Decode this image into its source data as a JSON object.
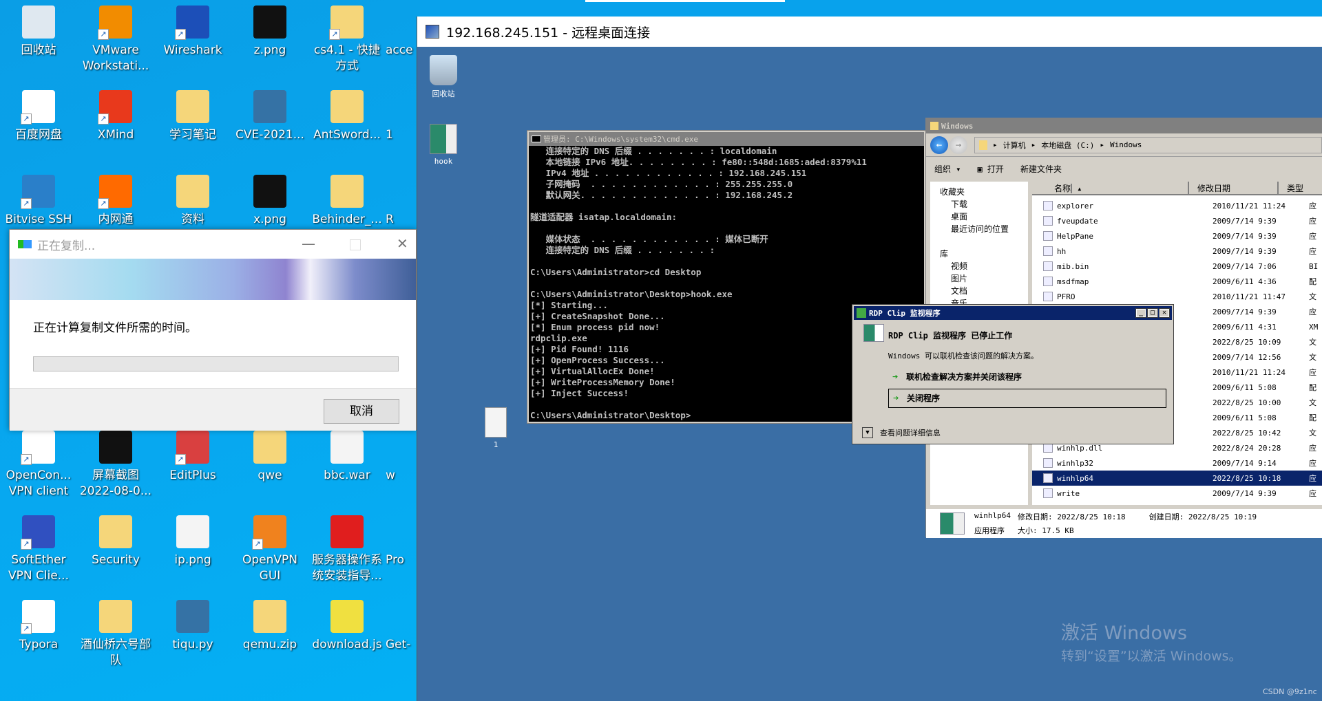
{
  "desktop": {
    "icons": [
      {
        "label": "回收站",
        "icon": "recycle-bin-icon",
        "color": "#dfe8f0",
        "shortcut": false
      },
      {
        "label": "VMware Workstati...",
        "icon": "vmware-icon",
        "color": "#f28c00",
        "shortcut": true
      },
      {
        "label": "Wireshark",
        "icon": "wireshark-icon",
        "color": "#1c4fb8",
        "shortcut": true
      },
      {
        "label": "z.png",
        "icon": "image-file-icon",
        "color": "#111111",
        "shortcut": false
      },
      {
        "label": "cs4.1 - 快捷方式",
        "icon": "folder-icon",
        "color": "#f5d67a",
        "shortcut": true
      },
      {
        "label": "百度网盘",
        "icon": "baidu-netdisk-icon",
        "color": "#ffffff",
        "shortcut": true
      },
      {
        "label": "XMind",
        "icon": "xmind-icon",
        "color": "#e8391c",
        "shortcut": true
      },
      {
        "label": "学习笔记",
        "icon": "folder-icon",
        "color": "#f5d67a",
        "shortcut": false
      },
      {
        "label": "CVE-2021...",
        "icon": "python-file-icon",
        "color": "#3572a5",
        "shortcut": false
      },
      {
        "label": "AntSword...",
        "icon": "zip-folder-icon",
        "color": "#f5d67a",
        "shortcut": false
      },
      {
        "label": "Bitvise SSH",
        "icon": "bitvise-icon",
        "color": "#2a7fc9",
        "shortcut": true
      },
      {
        "label": "内网通",
        "icon": "neiwangtong-icon",
        "color": "#ff6a00",
        "shortcut": true
      },
      {
        "label": "资料",
        "icon": "folder-icon",
        "color": "#f5d67a",
        "shortcut": false
      },
      {
        "label": "x.png",
        "icon": "image-file-icon",
        "color": "#111111",
        "shortcut": false
      },
      {
        "label": "Behinder_...",
        "icon": "zip-folder-icon",
        "color": "#f5d67a",
        "shortcut": false
      },
      {
        "label": "OpenCon... VPN client",
        "icon": "lock-icon",
        "color": "#ffffff",
        "shortcut": true
      },
      {
        "label": "屏幕截图 2022-08-0...",
        "icon": "image-file-icon",
        "color": "#111111",
        "shortcut": false
      },
      {
        "label": "EditPlus",
        "icon": "editplus-icon",
        "color": "#d94040",
        "shortcut": true
      },
      {
        "label": "qwe",
        "icon": "folder-icon",
        "color": "#f5d67a",
        "shortcut": false
      },
      {
        "label": "bbc.war",
        "icon": "file-icon",
        "color": "#f4f4f4",
        "shortcut": false
      },
      {
        "label": "SoftEther VPN Clie...",
        "icon": "softether-icon",
        "color": "#3050c0",
        "shortcut": true
      },
      {
        "label": "Security",
        "icon": "folder-icon",
        "color": "#f5d67a",
        "shortcut": false
      },
      {
        "label": "ip.png",
        "icon": "image-file-icon",
        "color": "#f4f4f4",
        "shortcut": false
      },
      {
        "label": "OpenVPN GUI",
        "icon": "openvpn-icon",
        "color": "#f0821e",
        "shortcut": true
      },
      {
        "label": "服务器操作系统安装指导...",
        "icon": "pdf-icon",
        "color": "#e01e1e",
        "shortcut": false
      },
      {
        "label": "Typora",
        "icon": "typora-icon",
        "color": "#ffffff",
        "shortcut": true
      },
      {
        "label": "酒仙桥六号部队",
        "icon": "folder-icon",
        "color": "#f5d67a",
        "shortcut": false
      },
      {
        "label": "tiqu.py",
        "icon": "python-file-icon",
        "color": "#3572a5",
        "shortcut": false
      },
      {
        "label": "qemu.zip",
        "icon": "zip-folder-icon",
        "color": "#f5d67a",
        "shortcut": false
      },
      {
        "label": "download.js",
        "icon": "script-file-icon",
        "color": "#f0e040",
        "shortcut": false
      }
    ],
    "cut_labels": [
      "acce",
      "1",
      "R",
      "w",
      "Pro",
      "Get-"
    ]
  },
  "copy_dialog": {
    "title": "正在复制...",
    "message": "正在计算复制文件所需的时间。",
    "progress_percent": 0,
    "cancel_label": "取消"
  },
  "rdp": {
    "title": "192.168.245.151 - 远程桌面连接",
    "icons": [
      {
        "label": "回收站"
      },
      {
        "label": "hook"
      },
      {
        "label": "1"
      }
    ],
    "cmd": {
      "title": "管理员: C:\\Windows\\system32\\cmd.exe",
      "lines": [
        "   连接特定的 DNS 后缀 . . . . . . . : localdomain",
        "   本地链接 IPv6 地址. . . . . . . . : fe80::548d:1685:aded:8379%11",
        "   IPv4 地址 . . . . . . . . . . . . : 192.168.245.151",
        "   子网掩码  . . . . . . . . . . . . : 255.255.255.0",
        "   默认网关. . . . . . . . . . . . . : 192.168.245.2",
        "",
        "隧道适配器 isatap.localdomain:",
        "",
        "   媒体状态  . . . . . . . . . . . . : 媒体已断开",
        "   连接特定的 DNS 后缀 . . . . . . . :",
        "",
        "C:\\Users\\Administrator>cd Desktop",
        "",
        "C:\\Users\\Administrator\\Desktop>hook.exe",
        "[*] Starting...",
        "[+] CreateSnapshot Done...",
        "[*] Enum process pid now!",
        "rdpclip.exe",
        "[+] Pid Found! 1116",
        "[+] OpenProcess Success...",
        "[+] VirtualAllocEx Done!",
        "[+] WriteProcessMemory Done!",
        "[+] Inject Success!",
        "",
        "C:\\Users\\Administrator\\Desktop>"
      ]
    },
    "explorer": {
      "title": "Windows",
      "breadcrumb": [
        "计算机",
        "本地磁盘 (C:)",
        "Windows"
      ],
      "toolbar": {
        "organize": "组织",
        "open": "打开",
        "new_folder": "新建文件夹"
      },
      "nav": [
        "收藏夹",
        "下载",
        "桌面",
        "最近访问的位置",
        "",
        "库",
        "视频",
        "图片",
        "文档",
        "音乐"
      ],
      "columns": [
        "名称",
        "修改日期",
        "类型"
      ],
      "rows": [
        {
          "name": "explorer",
          "date": "2010/11/21 11:24",
          "type": "应"
        },
        {
          "name": "fveupdate",
          "date": "2009/7/14 9:39",
          "type": "应"
        },
        {
          "name": "HelpPane",
          "date": "2009/7/14 9:39",
          "type": "应"
        },
        {
          "name": "hh",
          "date": "2009/7/14 9:39",
          "type": "应"
        },
        {
          "name": "mib.bin",
          "date": "2009/7/14 7:06",
          "type": "BI"
        },
        {
          "name": "msdfmap",
          "date": "2009/6/11 4:36",
          "type": "配"
        },
        {
          "name": "PFRO",
          "date": "2010/11/21 11:47",
          "type": "文"
        },
        {
          "name": "",
          "date": "2009/7/14 9:39",
          "type": "应"
        },
        {
          "name": "",
          "date": "2009/6/11 4:31",
          "type": "XM"
        },
        {
          "name": "",
          "date": "2022/8/25 10:09",
          "type": "文"
        },
        {
          "name": "",
          "date": "2009/7/14 12:56",
          "type": "文"
        },
        {
          "name": "",
          "date": "2010/11/21 11:24",
          "type": "应"
        },
        {
          "name": "",
          "date": "2009/6/11 5:08",
          "type": "配"
        },
        {
          "name": "",
          "date": "2022/8/25 10:00",
          "type": "文"
        },
        {
          "name": "",
          "date": "2009/6/11 5:08",
          "type": "配"
        },
        {
          "name": "",
          "date": "2022/8/25 10:42",
          "type": "文"
        },
        {
          "name": "winhlp.dll",
          "date": "2022/8/24 20:28",
          "type": "应"
        },
        {
          "name": "winhlp32",
          "date": "2009/7/14 9:14",
          "type": "应"
        },
        {
          "name": "winhlp64",
          "date": "2022/8/25 10:18",
          "type": "应",
          "selected": true
        },
        {
          "name": "write",
          "date": "2009/7/14 9:39",
          "type": "应"
        }
      ],
      "status": {
        "name": "winhlp64",
        "modified": "修改日期: 2022/8/25 10:18",
        "created": "创建日期: 2022/8/25 10:19",
        "kind": "应用程序",
        "size": "大小: 17.5 KB"
      }
    },
    "clip_dialog": {
      "title": "RDP Clip 监视程序",
      "heading": "RDP Clip 监视程序 已停止工作",
      "message": "Windows 可以联机检查该问题的解决方案。",
      "option1": "联机检查解决方案并关闭该程序",
      "option2": "关闭程序",
      "details": "查看问题详细信息"
    },
    "watermark": {
      "line1": "激活 Windows",
      "line2": "转到“设置”以激活 Windows。"
    }
  },
  "credit": "CSDN @9z1nc"
}
